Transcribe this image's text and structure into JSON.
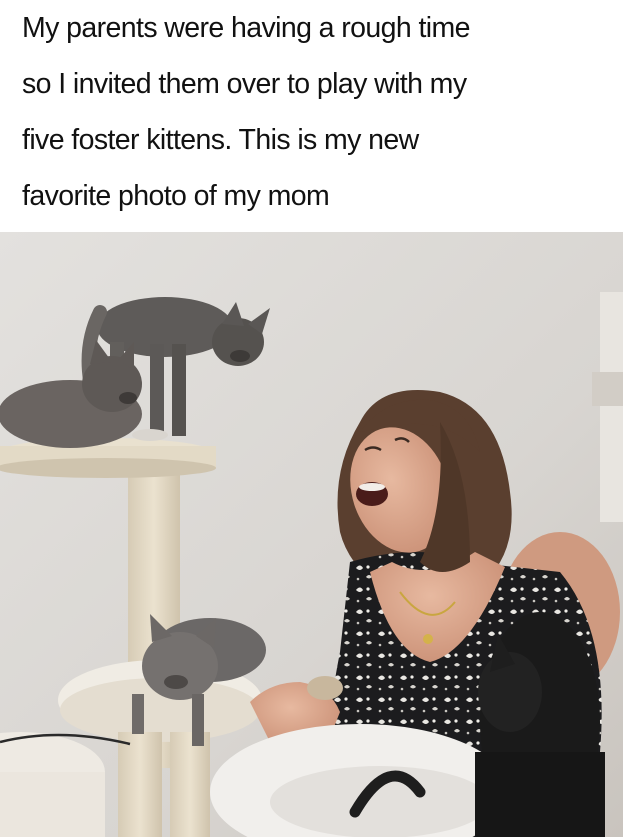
{
  "caption": {
    "lines": [
      "My parents were having a rough time",
      "so I invited them over to play with my",
      "five foster kittens. This is my new",
      "favorite photo of my mom"
    ]
  },
  "photo": {
    "colors": {
      "wall": "#dcd9d5",
      "cat_tree": "#e6ddc9",
      "kitten": "#5d5a58",
      "hair": "#5a3f2f",
      "skin": "#d9a98f",
      "dress": "#1d1d1f",
      "cat_bed": "#f1efec"
    }
  }
}
